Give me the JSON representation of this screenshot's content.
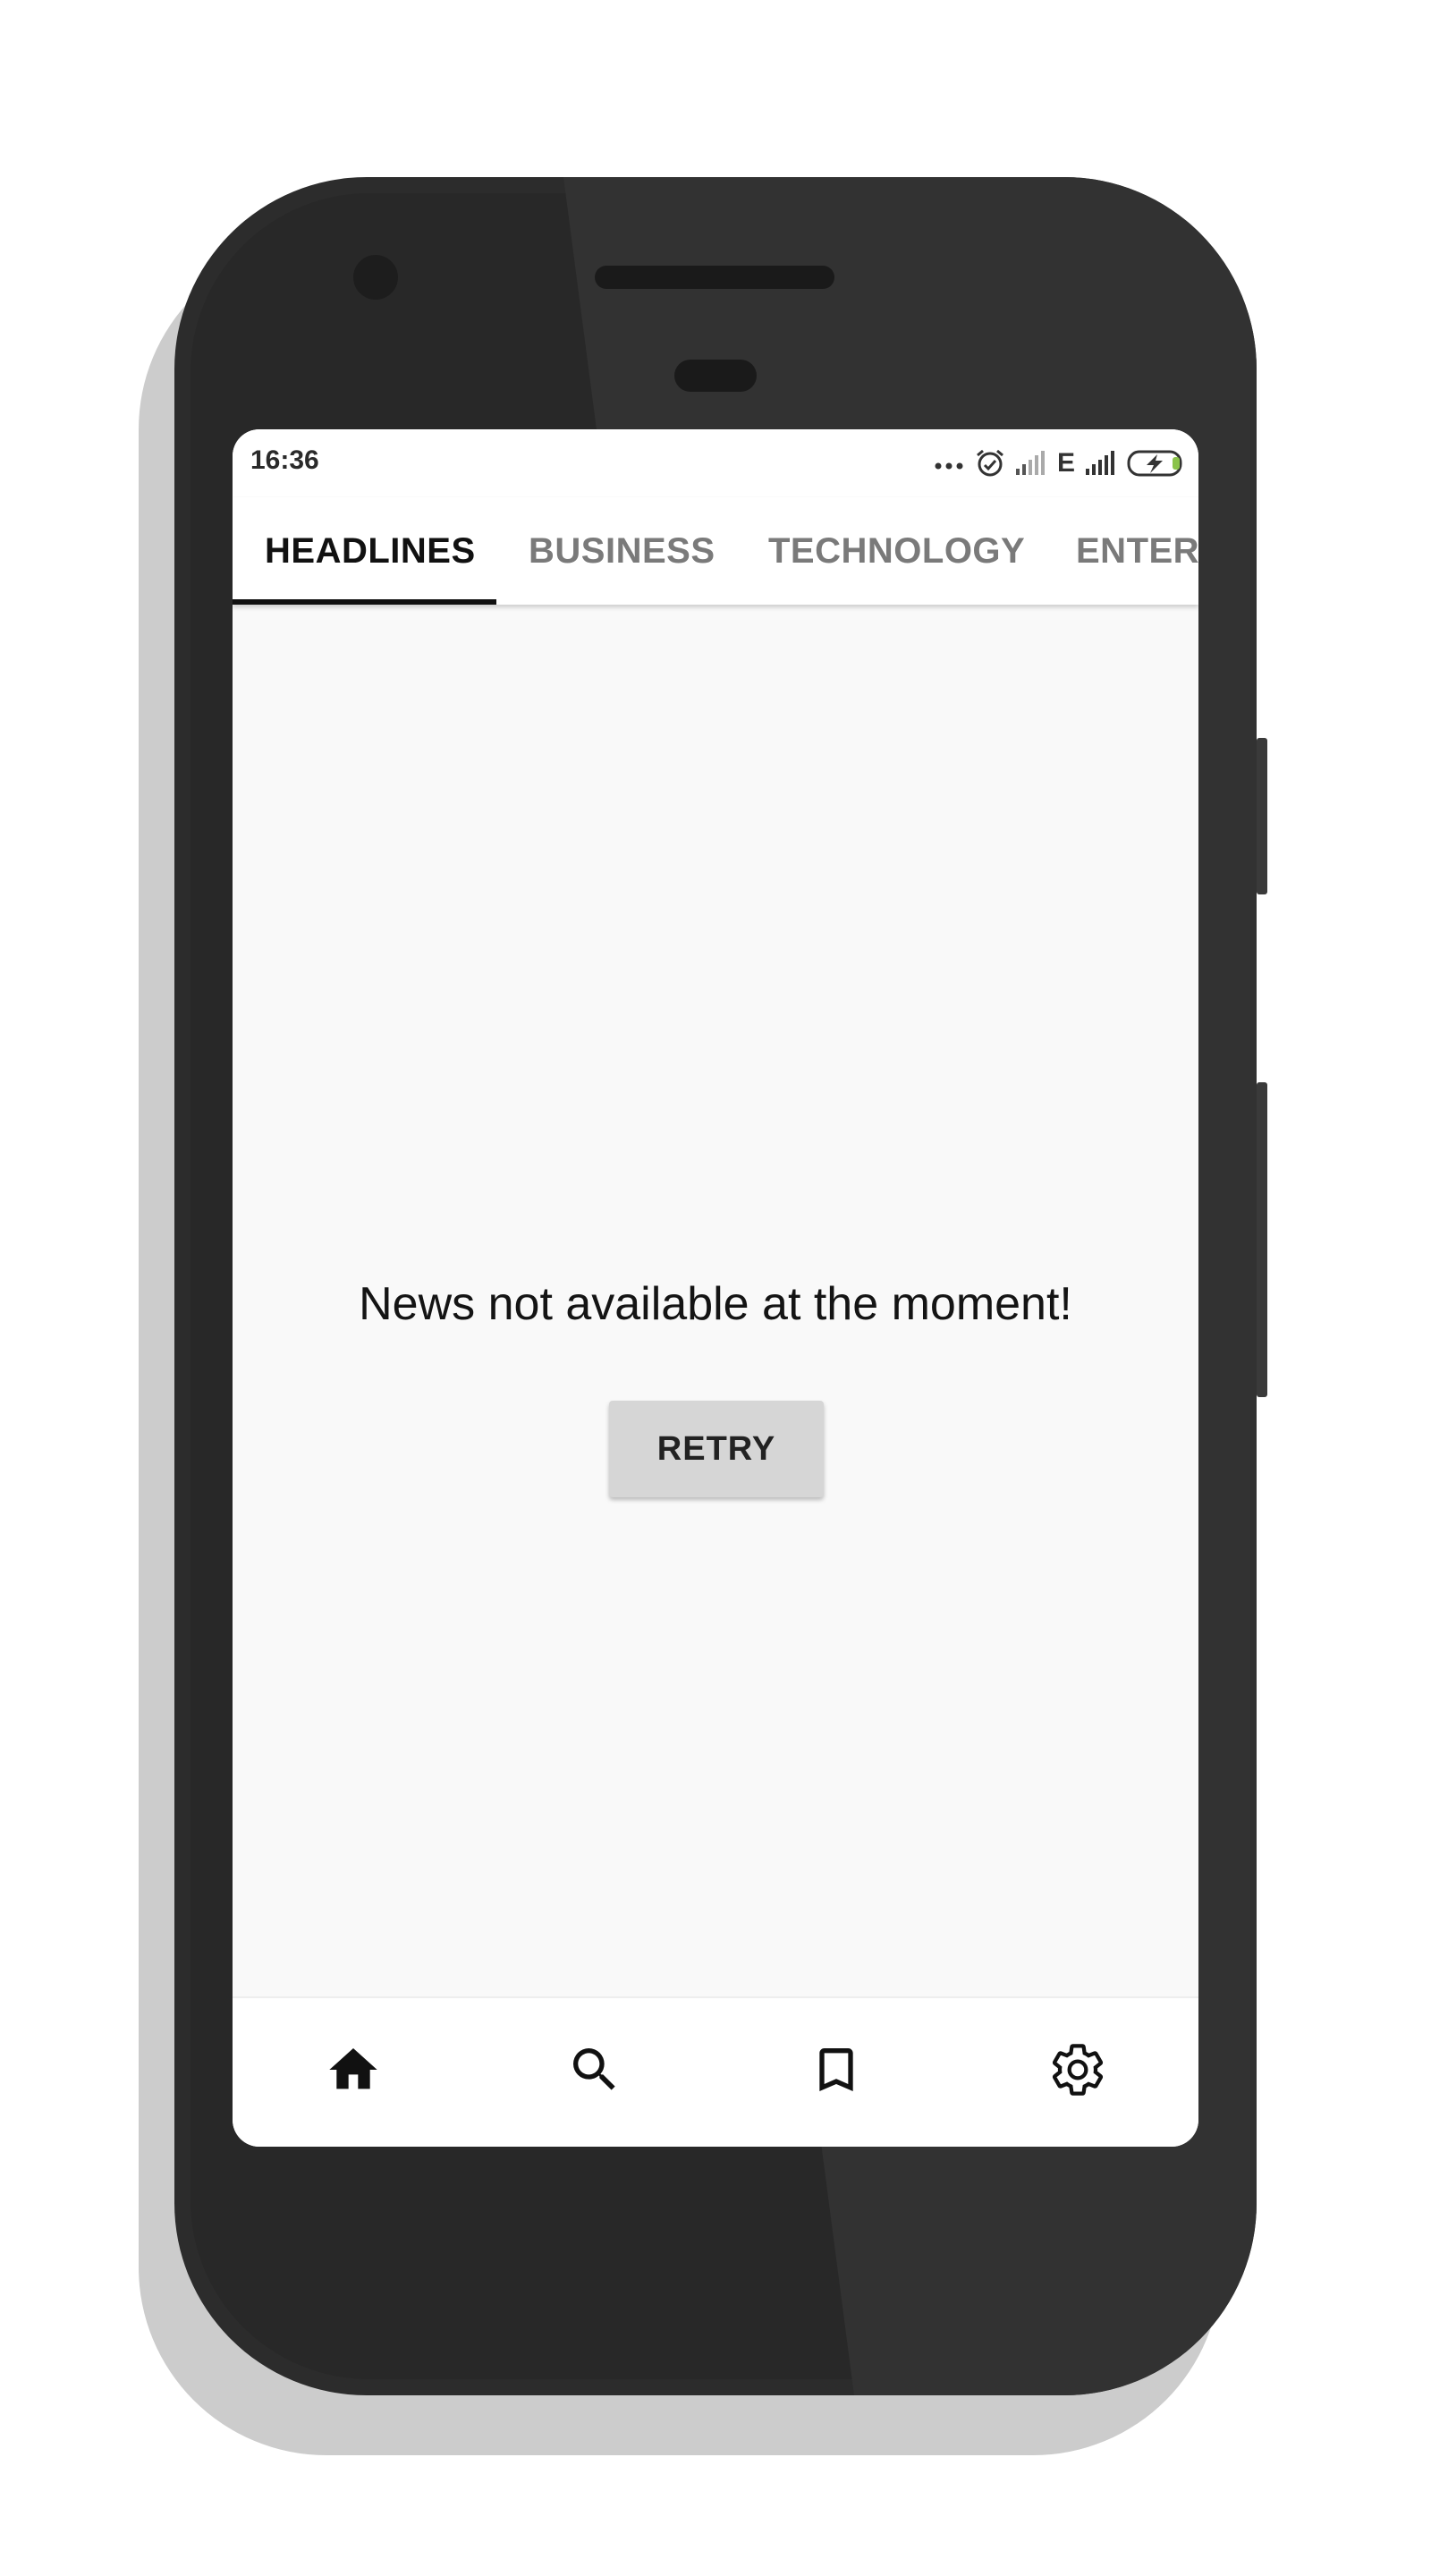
{
  "status_bar": {
    "time": "16:36",
    "network_type": "E",
    "icons": [
      "more-dots-icon",
      "alarm-icon",
      "signal-icon",
      "signal-icon",
      "battery-charging-icon"
    ]
  },
  "tabs": [
    {
      "label": "HEADLINES",
      "active": true
    },
    {
      "label": "BUSINESS",
      "active": false
    },
    {
      "label": "TECHNOLOGY",
      "active": false
    },
    {
      "label": "ENTERT",
      "active": false
    }
  ],
  "content": {
    "message": "News not available at the moment!",
    "retry_label": "RETRY"
  },
  "bottom_nav": [
    {
      "icon": "home-icon",
      "active": true
    },
    {
      "icon": "search-icon",
      "active": false
    },
    {
      "icon": "bookmark-icon",
      "active": false
    },
    {
      "icon": "settings-icon",
      "active": false
    }
  ],
  "colors": {
    "phone_body": "#2c2c2c",
    "screen_background": "#f9f9f9",
    "active_tab": "#111111",
    "inactive_tab": "#7a7a7a",
    "retry_button": "#d6d6d6",
    "battery_accent": "#8bc34a"
  }
}
